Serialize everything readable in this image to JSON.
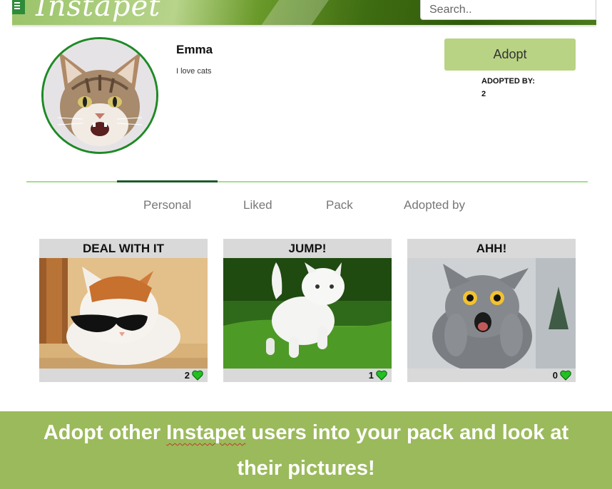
{
  "header": {
    "logo_text": "Instapet",
    "search_placeholder": "Search.."
  },
  "profile": {
    "name": "Emma",
    "bio": "I love cats",
    "adopt_button": "Adopt",
    "adopted_by_label": "ADOPTED BY:",
    "adopted_by_count": "2"
  },
  "tabs": [
    {
      "label": "Personal",
      "active": true
    },
    {
      "label": "Liked",
      "active": false
    },
    {
      "label": "Pack",
      "active": false
    },
    {
      "label": "Adopted by",
      "active": false
    }
  ],
  "posts": [
    {
      "title": "DEAL WITH IT",
      "likes": "2",
      "image": "cat-with-sunglasses"
    },
    {
      "title": "JUMP!",
      "likes": "1",
      "image": "white-cat-jumping-on-grass"
    },
    {
      "title": "AHH!",
      "likes": "0",
      "image": "surprised-gray-cat"
    }
  ],
  "banner": {
    "line1_before": "Adopt other ",
    "line1_brand": "Instapet",
    "line1_after": " users into your pack and look at",
    "line2": "their pictures!"
  },
  "colors": {
    "accent_green": "#b9d384",
    "banner_green": "#9bba5b",
    "tab_line": "#a2e08a",
    "heart_green": "#22c022",
    "avatar_border": "#1e8a26"
  }
}
